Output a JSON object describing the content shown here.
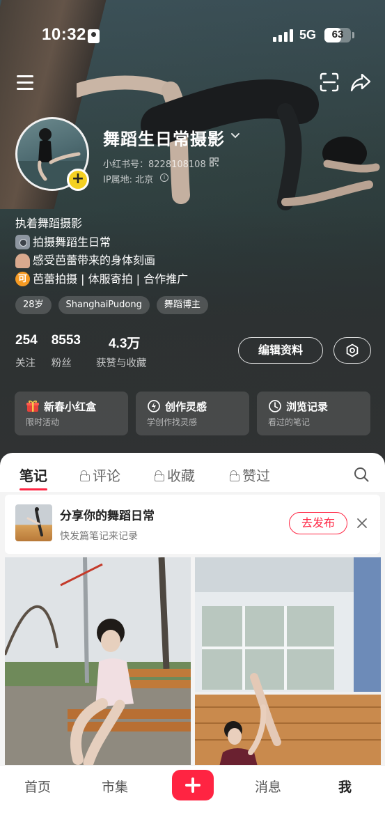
{
  "status_bar": {
    "time": "10:32",
    "network": "5G",
    "battery": "63",
    "battery_level": 0.63
  },
  "profile": {
    "nickname": "舞蹈生日常摄影",
    "id_text": "小红书号：8228108108",
    "ip_text": "IP属地: 北京",
    "bio": [
      "执着舞蹈摄影",
      "拍摄舞蹈生日常",
      "感受芭蕾带来的身体刻画",
      "芭蕾拍摄 | 体服寄拍 | 合作推广"
    ],
    "tags": [
      "28岁",
      "ShanghaiPudong",
      "舞蹈博主"
    ],
    "stats": [
      {
        "value": "254",
        "label": "关注"
      },
      {
        "value": "8553",
        "label": "粉丝"
      },
      {
        "value": "4.3万",
        "label": "获赞与收藏"
      }
    ],
    "edit_label": "编辑资料"
  },
  "feature_cards": [
    {
      "title": "新春小红盒",
      "subtitle": "限时活动",
      "icon": "gift-icon"
    },
    {
      "title": "创作灵感",
      "subtitle": "学创作找灵感",
      "icon": "lightbulb-icon"
    },
    {
      "title": "浏览记录",
      "subtitle": "看过的笔记",
      "icon": "clock-icon"
    }
  ],
  "content_tabs": [
    {
      "label": "笔记",
      "locked": false,
      "active": true
    },
    {
      "label": "评论",
      "locked": true
    },
    {
      "label": "收藏",
      "locked": true
    },
    {
      "label": "赞过",
      "locked": true
    }
  ],
  "publish_prompt": {
    "title": "分享你的舞蹈日常",
    "subtitle": "快发篇笔记来记录",
    "button": "去发布"
  },
  "bottom_nav": {
    "home": "首页",
    "market": "市集",
    "messages": "消息",
    "me": "我"
  },
  "colors": {
    "accent": "#ff2442",
    "tag_bg": "rgba(255,255,255,0.17)"
  }
}
